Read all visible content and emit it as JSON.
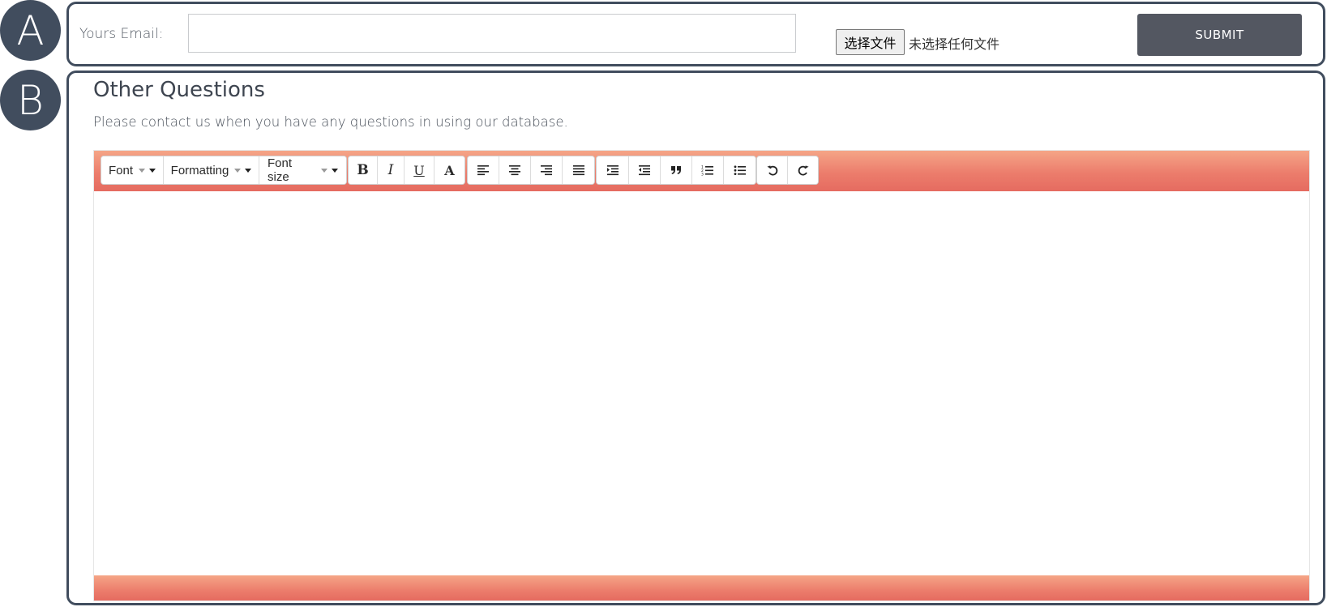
{
  "badges": {
    "a": "A",
    "b": "B"
  },
  "email_section": {
    "label": "Yours Email:",
    "input_value": "",
    "input_placeholder": "",
    "file_button_label": "选择文件",
    "file_status": "未选择任何文件",
    "submit_label": "SUBMIT"
  },
  "questions_section": {
    "title": "Other Questions",
    "description": "Please contact us when you have any questions in using our database."
  },
  "editor": {
    "toolbar_colors": {
      "gradient_top": "#f5a587",
      "gradient_bottom": "#e56b60"
    },
    "dropdowns": [
      {
        "label": "Font",
        "icon": "chevron-down-icon"
      },
      {
        "label": "Formatting",
        "icon": "chevron-down-icon"
      },
      {
        "label": "Font size",
        "icon": "chevron-down-icon"
      }
    ],
    "text_style_buttons": [
      {
        "name": "bold",
        "glyph": "B"
      },
      {
        "name": "italic",
        "glyph": "I"
      },
      {
        "name": "underline",
        "glyph": "U"
      },
      {
        "name": "font-color",
        "glyph": "A"
      }
    ],
    "align_buttons": [
      "align-left-icon",
      "align-center-icon",
      "align-right-icon",
      "align-justify-icon"
    ],
    "block_buttons": [
      "indent-icon",
      "outdent-icon",
      "blockquote-icon",
      "ordered-list-icon",
      "unordered-list-icon"
    ],
    "history_buttons": [
      "undo-icon",
      "redo-icon"
    ],
    "content": ""
  },
  "colors": {
    "badge_bg": "#414d5e",
    "panel_border": "#414d5e",
    "submit_bg": "#535761"
  }
}
